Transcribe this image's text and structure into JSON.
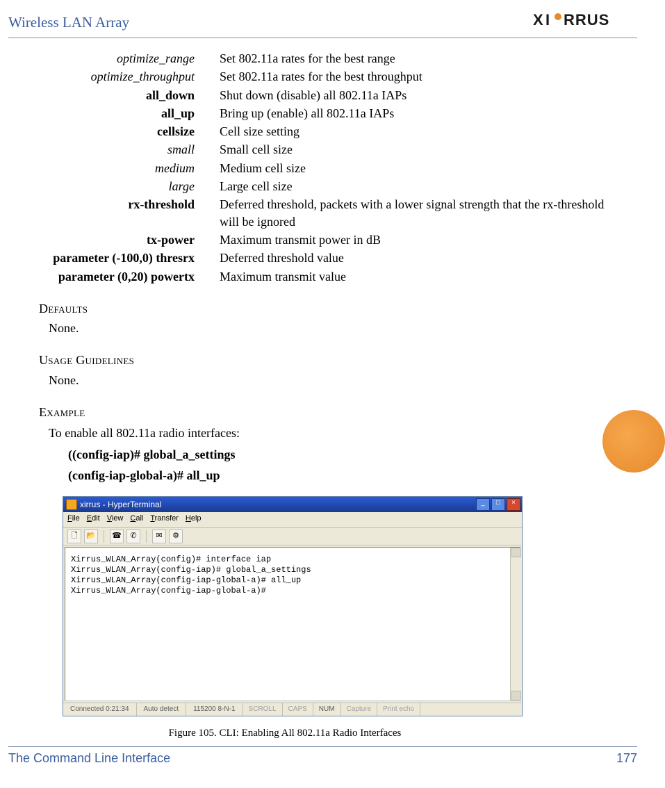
{
  "header": {
    "title": "Wireless LAN Array",
    "brand": "XIRRUS"
  },
  "definitions": [
    {
      "term": "optimize_range",
      "style": "italic",
      "desc": "Set 802.11a rates for the best range"
    },
    {
      "term": "optimize_throughput",
      "style": "italic",
      "desc": "Set 802.11a rates for the best throughput"
    },
    {
      "term": "all_down",
      "style": "bold",
      "desc": "Shut down (disable) all 802.11a IAPs"
    },
    {
      "term": "all_up",
      "style": "bold",
      "desc": "Bring up (enable) all 802.11a IAPs"
    },
    {
      "term": "cellsize",
      "style": "bold",
      "desc": "Cell size setting"
    },
    {
      "term": "small",
      "style": "italic",
      "desc": "Small cell size"
    },
    {
      "term": "medium",
      "style": "italic",
      "desc": "Medium cell size"
    },
    {
      "term": "large",
      "style": "italic",
      "desc": "Large cell size"
    },
    {
      "term": "rx-threshold",
      "style": "bold",
      "desc": "Deferred threshold, packets with a lower signal strength that the rx-threshold will be ignored"
    },
    {
      "term": "tx-power",
      "style": "bold",
      "desc": "Maximum transmit power in dB"
    },
    {
      "term": "parameter (-100,0) thresrx",
      "style": "bold",
      "desc": "Deferred threshold value"
    },
    {
      "term": "parameter (0,20) powertx",
      "style": "bold",
      "desc": "Maximum transmit value"
    }
  ],
  "sections": {
    "defaults": {
      "heading": "Defaults",
      "body": "None."
    },
    "usage": {
      "heading": "Usage Guidelines",
      "body": "None."
    },
    "example": {
      "heading": "Example",
      "intro": "To enable all 802.11a radio interfaces:"
    }
  },
  "commands": {
    "line1": "((config-iap)# global_a_settings",
    "line2": "(config-iap-global-a)# all_up"
  },
  "hyperterminal": {
    "title": "xirrus - HyperTerminal",
    "menus": [
      "File",
      "Edit",
      "View",
      "Call",
      "Transfer",
      "Help"
    ],
    "toolbar_icons": [
      "new-doc-icon",
      "open-icon",
      "connect-icon",
      "disconnect-icon",
      "send-icon",
      "properties-icon"
    ],
    "body_lines": [
      "Xirrus_WLAN_Array(config)# interface iap",
      "Xirrus_WLAN_Array(config-iap)# global_a_settings",
      "Xirrus_WLAN_Array(config-iap-global-a)# all_up",
      "Xirrus_WLAN_Array(config-iap-global-a)#"
    ],
    "status": {
      "connected": "Connected 0:21:34",
      "detect": "Auto detect",
      "baud": "115200 8-N-1",
      "scroll": "SCROLL",
      "caps": "CAPS",
      "num": "NUM",
      "capture": "Capture",
      "printecho": "Print echo"
    }
  },
  "figure_caption": "Figure 105. CLI: Enabling All 802.11a Radio Interfaces",
  "footer": {
    "section": "The Command Line Interface",
    "page": "177"
  }
}
